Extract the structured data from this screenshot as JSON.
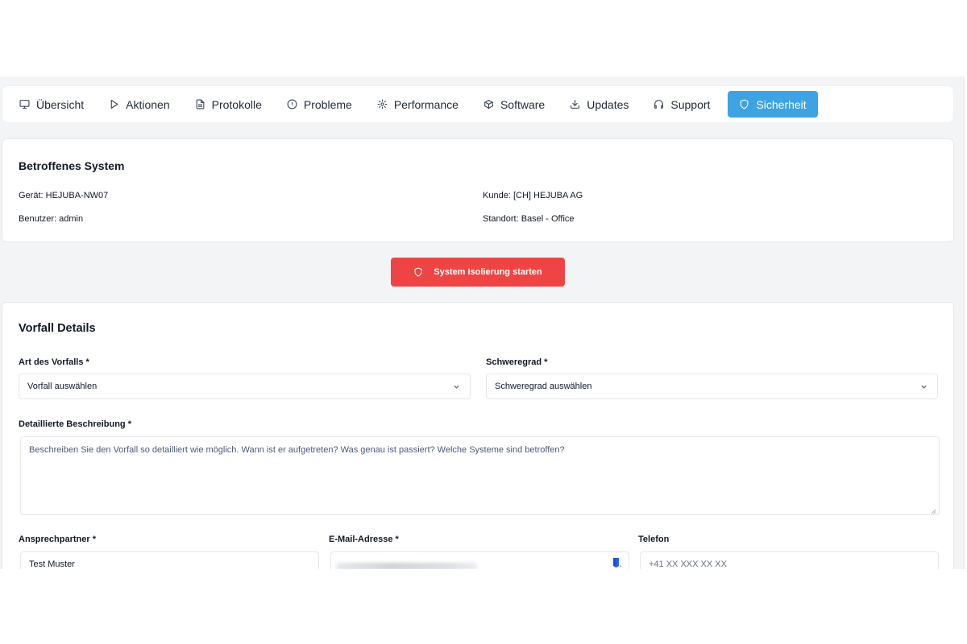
{
  "tabs": [
    {
      "label": "Übersicht",
      "icon": "monitor-icon"
    },
    {
      "label": "Aktionen",
      "icon": "play-icon"
    },
    {
      "label": "Protokolle",
      "icon": "file-text-icon"
    },
    {
      "label": "Probleme",
      "icon": "alert-circle-icon"
    },
    {
      "label": "Performance",
      "icon": "settings-icon"
    },
    {
      "label": "Software",
      "icon": "package-icon"
    },
    {
      "label": "Updates",
      "icon": "download-icon"
    },
    {
      "label": "Support",
      "icon": "headphones-icon"
    },
    {
      "label": "Sicherheit",
      "icon": "shield-icon",
      "active": true
    }
  ],
  "system": {
    "title": "Betroffenes System",
    "device_key": "Gerät:",
    "device_value": "HEJUBA-NW07",
    "user_key": "Benutzer:",
    "user_value": "admin",
    "customer_key": "Kunde:",
    "customer_value": "[CH] HEJUBA AG",
    "location_key": "Standort:",
    "location_value": "Basel - Office"
  },
  "isolation_button": {
    "label": "System Isolierung starten",
    "color": "#ef4444"
  },
  "incident": {
    "title": "Vorfall Details",
    "type_label": "Art des Vorfalls *",
    "type_value": "Vorfall auswählen",
    "severity_label": "Schweregrad *",
    "severity_value": "Schweregrad auswählen",
    "description_label": "Detaillierte Beschreibung *",
    "description_placeholder": "Beschreiben Sie den Vorfall so detailliert wie möglich. Wann ist er aufgetreten? Was genau ist passiert? Welche Systeme sind betroffen?",
    "contact_label": "Ansprechpartner *",
    "contact_value": "Test  Muster",
    "email_label": "E-Mail-Adresse *",
    "phone_label": "Telefon",
    "phone_placeholder": "+41 XX XXX XX XX"
  },
  "colors": {
    "accent": "#3ea3e2",
    "danger": "#ef4444",
    "background": "#f3f4f6"
  }
}
